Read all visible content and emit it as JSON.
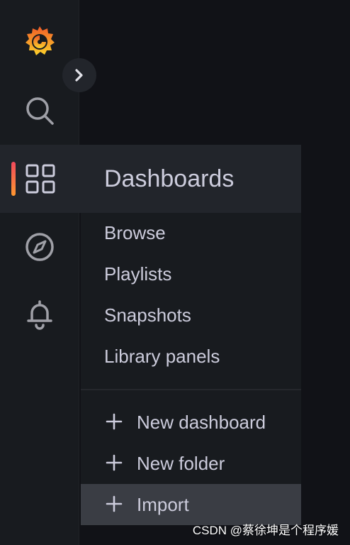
{
  "sidebar": {
    "logo": "grafana-logo",
    "expand_icon": "chevron-right-icon",
    "items": [
      {
        "name": "search",
        "icon": "search-icon"
      },
      {
        "name": "dashboards",
        "icon": "apps-grid-icon",
        "active": true
      },
      {
        "name": "explore",
        "icon": "compass-icon"
      },
      {
        "name": "alerting",
        "icon": "bell-icon"
      }
    ]
  },
  "dropdown": {
    "title": "Dashboards",
    "links": [
      "Browse",
      "Playlists",
      "Snapshots",
      "Library panels"
    ],
    "actions": [
      {
        "label": "New dashboard",
        "icon": "plus-icon"
      },
      {
        "label": "New folder",
        "icon": "plus-icon"
      },
      {
        "label": "Import",
        "icon": "plus-icon",
        "highlighted": true
      }
    ]
  },
  "watermark": "CSDN @蔡徐坤是个程序媛",
  "colors": {
    "background": "#111217",
    "sidebar": "#181b1f",
    "header": "#22252b",
    "text": "#ccccdc",
    "icon": "#9fa0a7",
    "accent_start": "#f2495c",
    "accent_end": "#ff9830",
    "highlight": "#3a3d44"
  }
}
